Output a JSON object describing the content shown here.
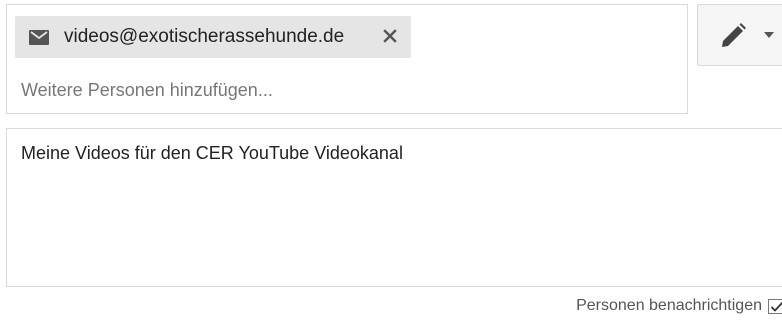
{
  "recipients": {
    "chip": {
      "icon": "mail-icon",
      "email": "videos@exotischerassehunde.de",
      "remove_icon": "close-icon"
    },
    "add_placeholder": "Weitere Personen hinzufügen..."
  },
  "permission": {
    "icon": "pencil-icon",
    "dropdown_icon": "chevron-down-icon"
  },
  "message": {
    "value": "Meine Videos für den CER YouTube Videokanal"
  },
  "notify": {
    "label": "Personen benachrichtigen",
    "checked": true
  },
  "colors": {
    "chip_bg": "#e5e5e5",
    "border": "#d9d9d9",
    "button_bg": "#f5f5f5",
    "icon": "#444444"
  }
}
